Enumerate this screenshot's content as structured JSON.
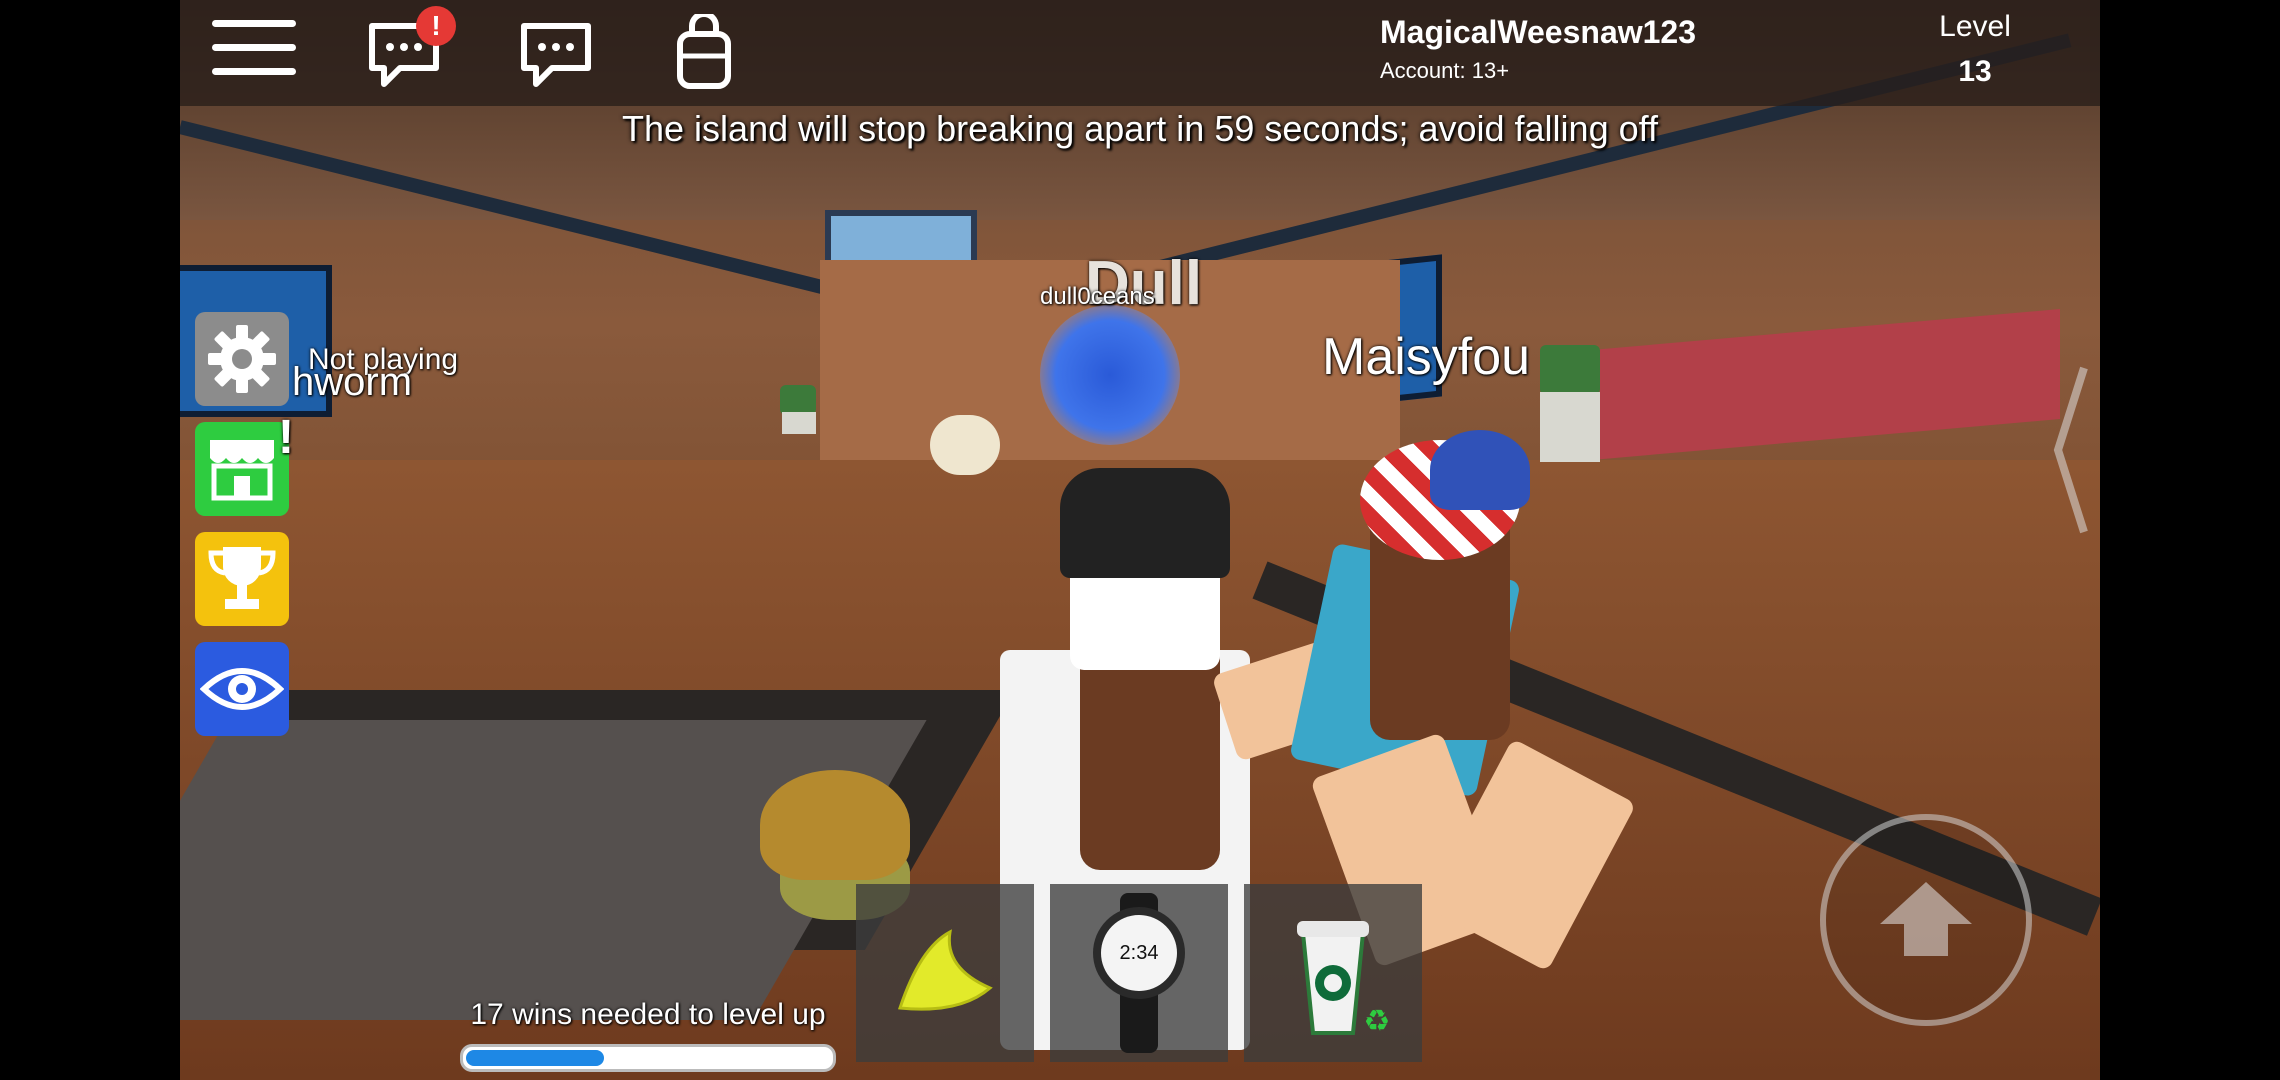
{
  "topbar": {
    "menu_icon": "hamburger-menu-icon",
    "chat_notification_badge": "!",
    "username": "MagicalWeesnaw123",
    "account": "Account: 13+",
    "level_label": "Level",
    "level_value": "13"
  },
  "announcement": "The island will stop breaking apart in 59 seconds; avoid falling off",
  "world_labels": {
    "dull_sign": "Dull",
    "player_dull0ceans": "dull0ceans",
    "player_maisyfou": "Maisyfou",
    "not_playing": "Not playing",
    "partial_name": "hworm"
  },
  "side_buttons": [
    {
      "name": "settings",
      "icon": "gear-icon",
      "color": "#8c8c8c"
    },
    {
      "name": "shop",
      "icon": "shop-icon",
      "color": "#2ecc40",
      "badge": "!"
    },
    {
      "name": "trophy",
      "icon": "trophy-icon",
      "color": "#f4c20d"
    },
    {
      "name": "spectate",
      "icon": "eye-icon",
      "color": "#2b5be0"
    }
  ],
  "hotbar": [
    {
      "item": "banana-peel-icon"
    },
    {
      "item": "watch-icon",
      "watch_time": "2:34"
    },
    {
      "item": "coffee-cup-icon"
    }
  ],
  "progress": {
    "label": "17 wins needed to level up",
    "fraction": 0.38
  },
  "colors": {
    "accent": "#1e88e5",
    "badge": "#e53935"
  }
}
